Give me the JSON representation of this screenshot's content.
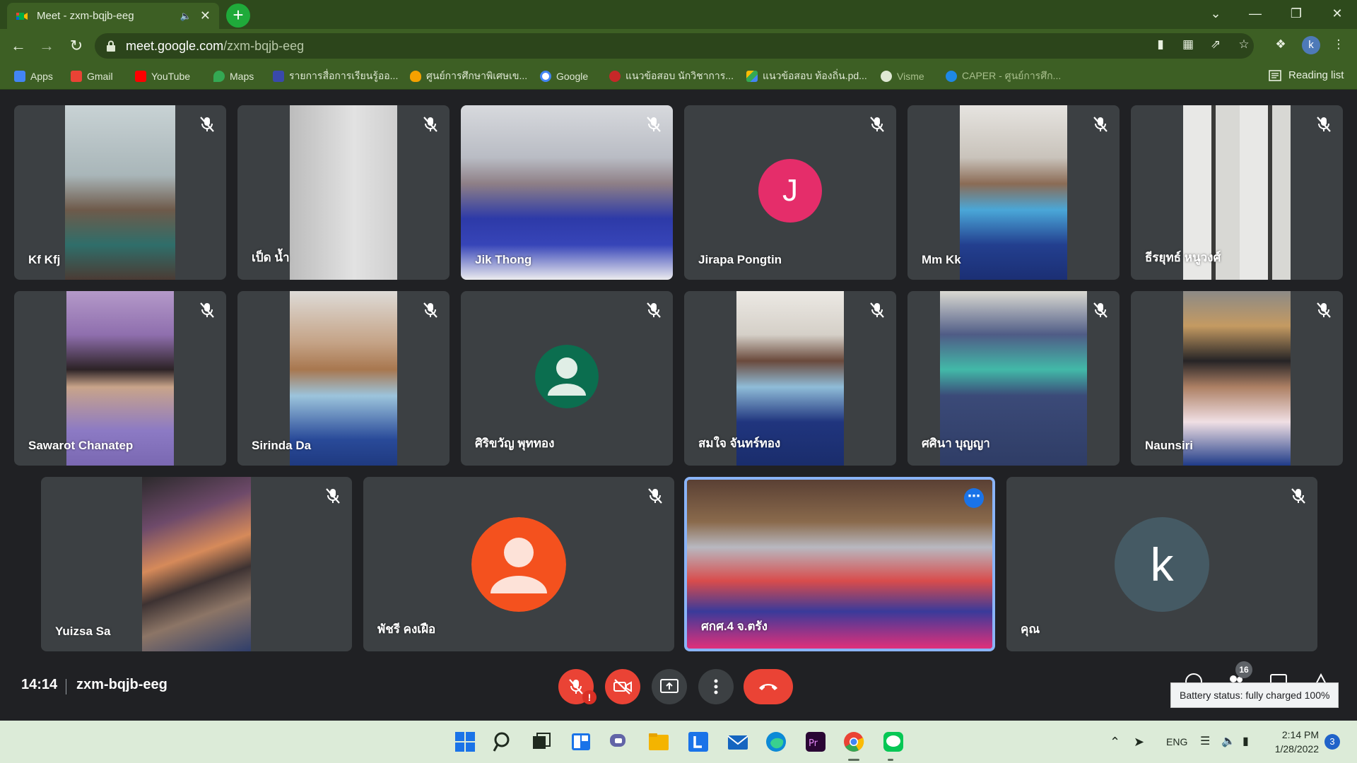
{
  "window": {
    "tab_title": "Meet - zxm-bqjb-eeg",
    "url_host": "meet.google.com",
    "url_path": "/zxm-bqjb-eeg",
    "profile_initial": "k"
  },
  "bookmarks": [
    {
      "label": "Apps",
      "icon": "apps-grid-icon",
      "color": "#4285f4"
    },
    {
      "label": "Gmail",
      "icon": "gmail-icon",
      "color": "#ea4335"
    },
    {
      "label": "YouTube",
      "icon": "youtube-icon",
      "color": "#ff0000"
    },
    {
      "label": "Maps",
      "icon": "maps-icon",
      "color": "#34a853"
    },
    {
      "label": "รายการสื่อการเรียนรู้ออ...",
      "icon": "calendar-icon",
      "color": "#3949ab"
    },
    {
      "label": "ศูนย์การศึกษาพิเศษเข...",
      "icon": "flame-icon",
      "color": "#f4a100"
    },
    {
      "label": "Google",
      "icon": "google-icon",
      "color": "#ffffff"
    },
    {
      "label": "แนวข้อสอบ นักวิชาการ...",
      "icon": "swirl-icon",
      "color": "#c62828"
    },
    {
      "label": "แนวข้อสอบ ท้องถิ่น.pd...",
      "icon": "drive-icon",
      "color": "#fbbc04"
    },
    {
      "label": "Visme",
      "icon": "visme-icon",
      "color": "#9aa0a6"
    },
    {
      "label": "CAPER - ศูนย์การศึก...",
      "icon": "caper-icon",
      "color": "#1e88e5"
    }
  ],
  "reading_list": "Reading list",
  "participants_row1": [
    {
      "name": "Kf Kfj",
      "muted": true
    },
    {
      "name": "เป็ด น้ำ",
      "muted": true
    },
    {
      "name": "Jik Thong",
      "muted": true
    },
    {
      "name": "Jirapa Pongtin",
      "muted": true,
      "avatar_letter": "J",
      "avatar_color": "#e52d6a"
    },
    {
      "name": "Mm Kk",
      "muted": true
    },
    {
      "name": "ธีรยุทธ์ หนูวงศ์",
      "muted": true
    }
  ],
  "participants_row2": [
    {
      "name": "Sawarot Chanatep",
      "muted": true
    },
    {
      "name": "Sirinda Da",
      "muted": true
    },
    {
      "name": "ศิริขวัญ พุททอง",
      "muted": true,
      "avatar_color": "#0b6e4f"
    },
    {
      "name": "สมใจ จันทร์ทอง",
      "muted": true
    },
    {
      "name": "ศศินา บุญญา",
      "muted": true
    },
    {
      "name": "Naunsiri",
      "muted": true
    }
  ],
  "participants_row3": [
    {
      "name": "Yuizsa Sa",
      "muted": true
    },
    {
      "name": "พัชรี คงเฝือ",
      "muted": true,
      "avatar_color": "#f4511e"
    },
    {
      "name": "ศกศ.4 จ.ตรัง",
      "muted": false,
      "active_speaker": true
    },
    {
      "name": "คุณ",
      "muted": true,
      "avatar_letter": "k",
      "avatar_color": "#455a64"
    }
  ],
  "controls": {
    "time": "14:14",
    "meeting_code": "zxm-bqjb-eeg",
    "participant_count": "16",
    "alert_mark": "!"
  },
  "tooltip": "Battery status: fully charged 100%",
  "taskbar": {
    "language": "ENG",
    "time": "2:14 PM",
    "date": "1/28/2022",
    "notifications": "3"
  }
}
